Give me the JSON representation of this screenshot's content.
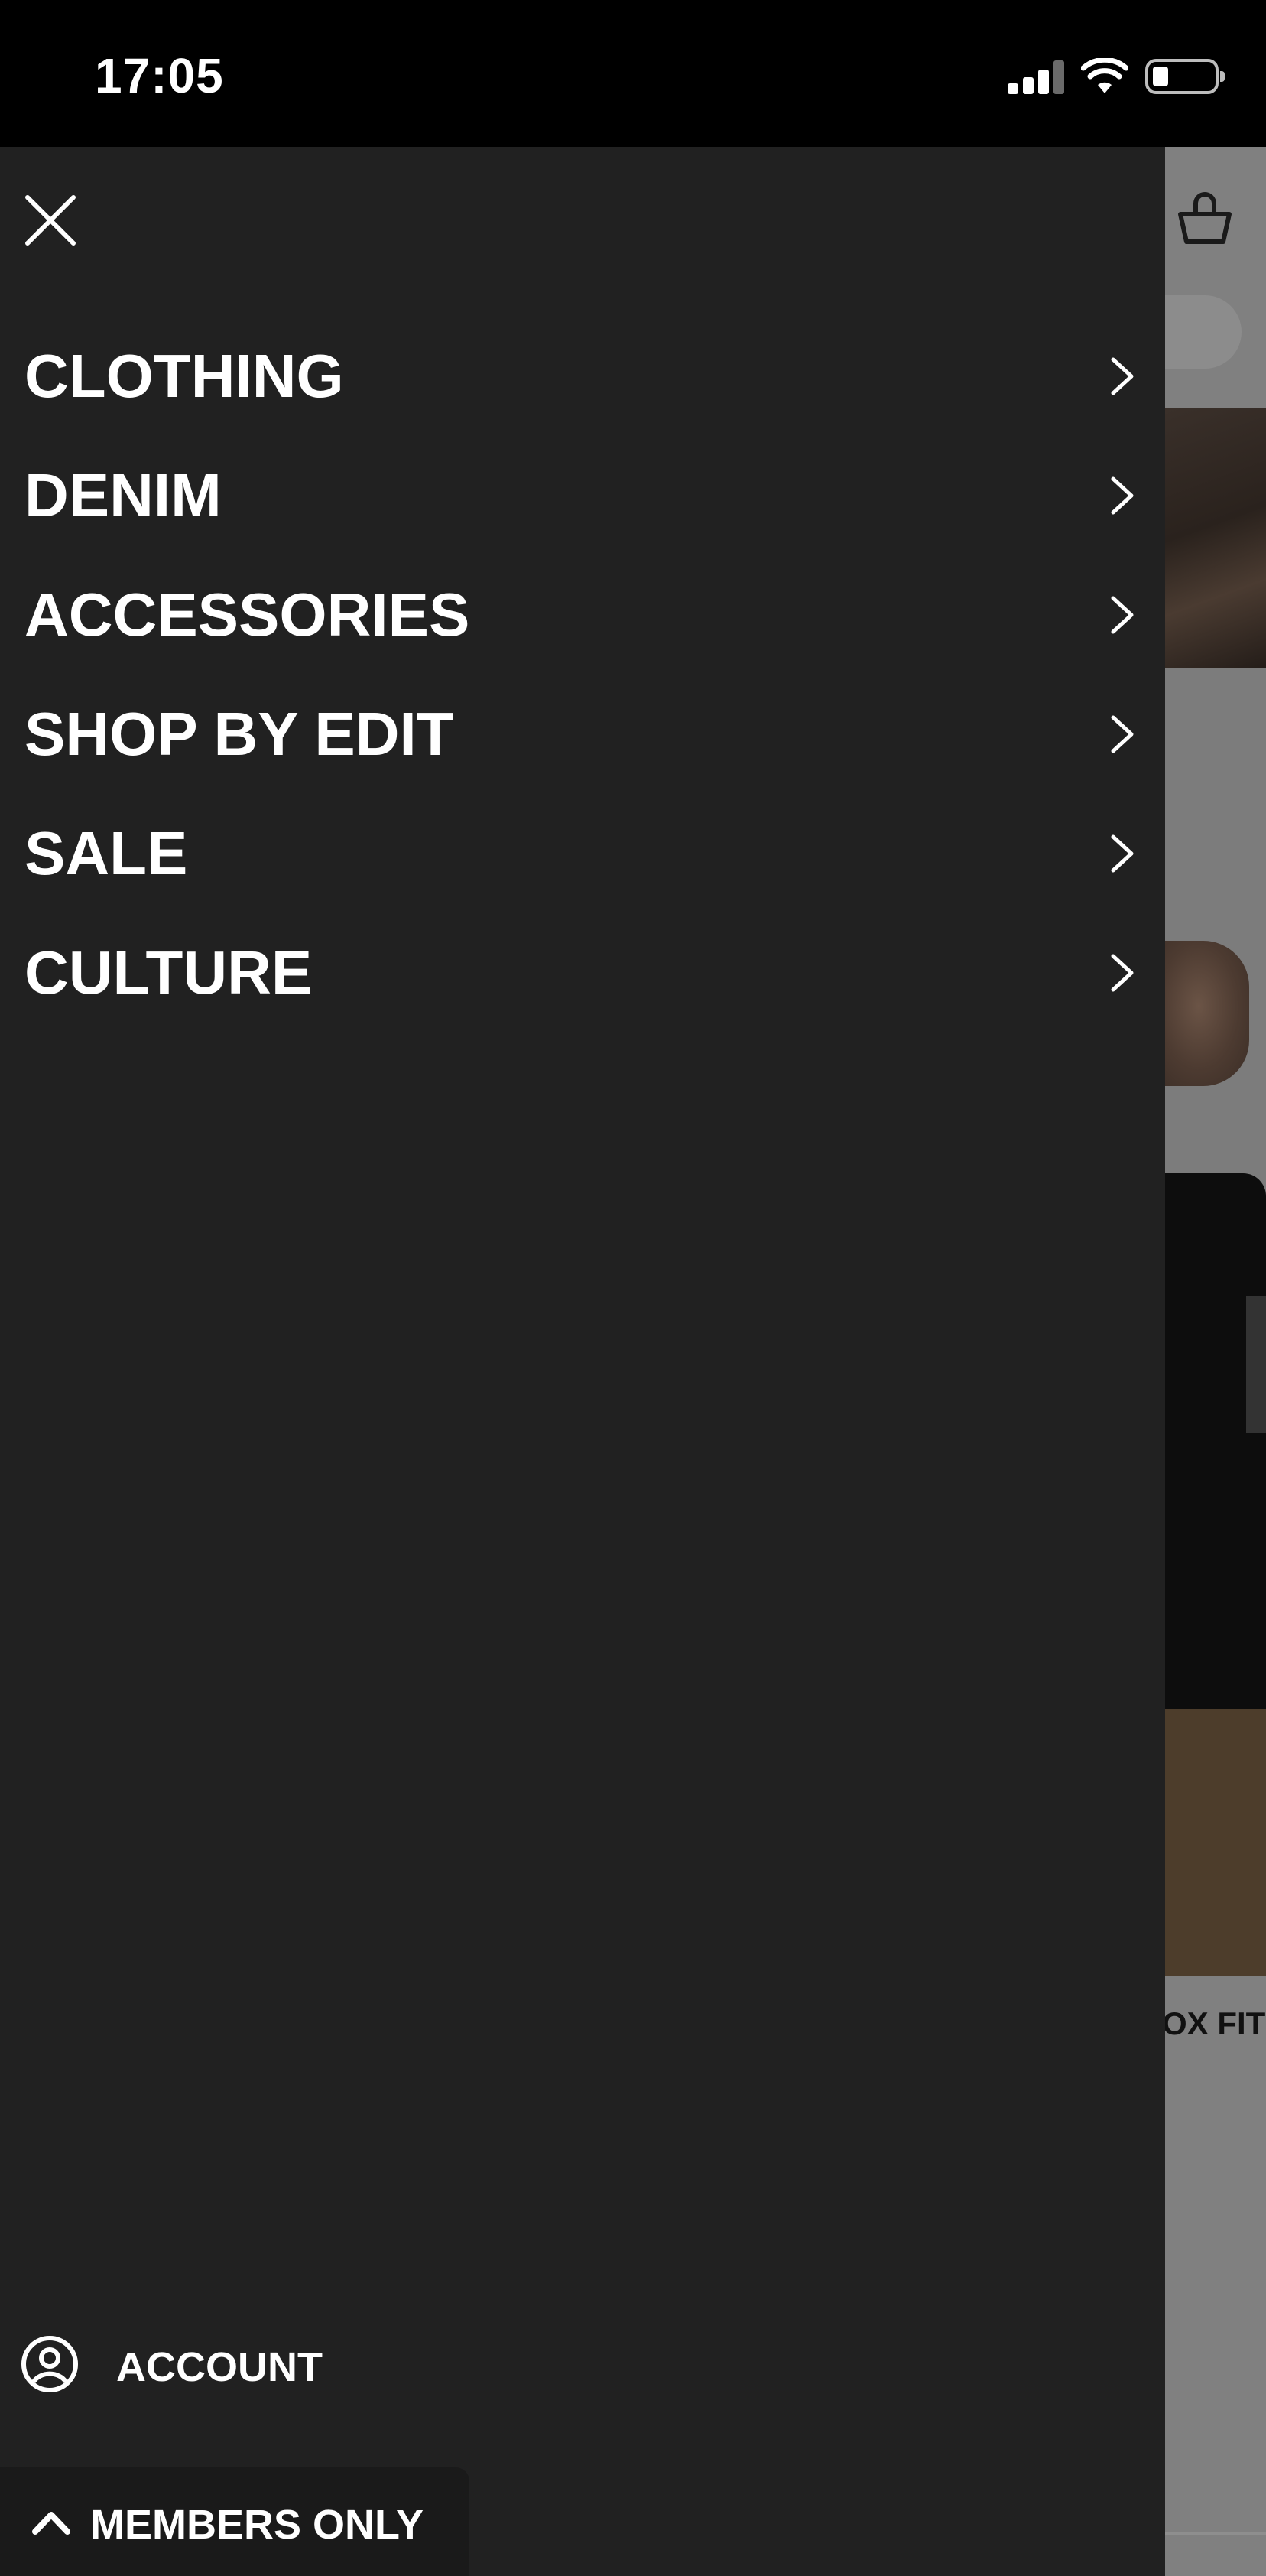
{
  "status_bar": {
    "time": "17:05",
    "icons": [
      "signal-icon",
      "wifi-icon",
      "battery-icon"
    ]
  },
  "drawer": {
    "close_icon": "close-icon",
    "menu_items": [
      {
        "label": "CLOTHING",
        "icon": "chevron-right-icon"
      },
      {
        "label": "DENIM",
        "icon": "chevron-right-icon"
      },
      {
        "label": "ACCESSORIES",
        "icon": "chevron-right-icon"
      },
      {
        "label": "SHOP BY EDIT",
        "icon": "chevron-right-icon"
      },
      {
        "label": "SALE",
        "icon": "chevron-right-icon"
      },
      {
        "label": "CULTURE",
        "icon": "chevron-right-icon"
      }
    ],
    "account": {
      "label": "ACCOUNT",
      "icon": "account-icon"
    },
    "members": {
      "label": "MEMBERS ONLY",
      "icon": "chevron-up-icon"
    }
  },
  "background_page": {
    "basket_icon": "basket-icon",
    "product_caption_visible": "OX FIT"
  },
  "colors": {
    "drawer_bg": "#212121",
    "members_bar_bg": "#1a1a1a",
    "text": "#ffffff",
    "status_bar_bg": "#000000",
    "overlay_dim": "#808080"
  }
}
